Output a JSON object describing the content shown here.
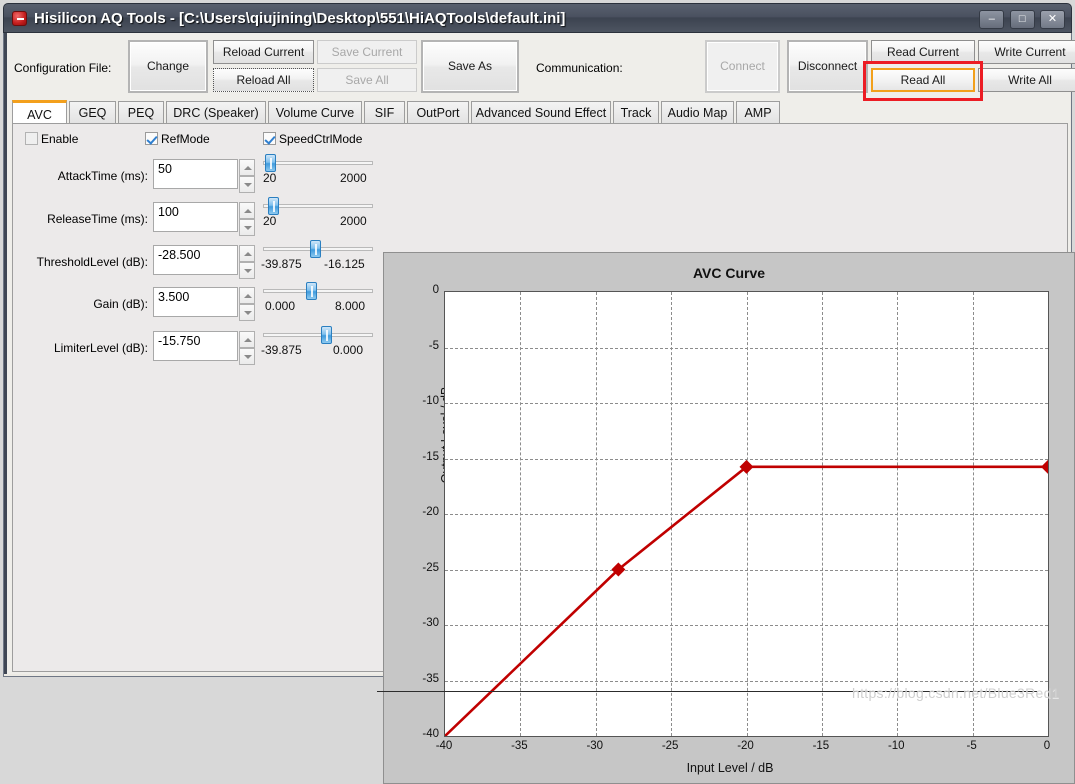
{
  "window": {
    "title": "Hisilicon AQ Tools - [C:\\Users\\qiujining\\Desktop\\551\\HiAQTools\\default.ini]",
    "app_icon": "app-icon",
    "minimize": "–",
    "maximize": "□",
    "close": "✕"
  },
  "toolbar": {
    "config_label": "Configuration File:",
    "change": "Change",
    "reload_current": "Reload Current",
    "reload_all": "Reload All",
    "save_current": "Save Current",
    "save_all": "Save All",
    "save_as": "Save As",
    "communication_label": "Communication:",
    "connect": "Connect",
    "disconnect": "Disconnect",
    "read_current": "Read Current",
    "read_all": "Read All",
    "write_current": "Write Current",
    "write_all": "Write All",
    "highlight_color": "#f2a01b",
    "annotation_color": "#ec1c24"
  },
  "tabs": [
    {
      "label": "AVC",
      "active": true
    },
    {
      "label": "GEQ",
      "active": false
    },
    {
      "label": "PEQ",
      "active": false
    },
    {
      "label": "DRC (Speaker)",
      "active": false
    },
    {
      "label": "Volume Curve",
      "active": false
    },
    {
      "label": "SIF",
      "active": false
    },
    {
      "label": "OutPort",
      "active": false
    },
    {
      "label": "Advanced Sound Effect",
      "active": false
    },
    {
      "label": "Track",
      "active": false
    },
    {
      "label": "Audio Map",
      "active": false
    },
    {
      "label": "AMP",
      "active": false
    }
  ],
  "avc": {
    "checkboxes": [
      {
        "label": "Enable",
        "checked": false
      },
      {
        "label": "RefMode",
        "checked": true
      },
      {
        "label": "SpeedCtrlMode",
        "checked": true
      }
    ],
    "params": [
      {
        "label": "AttackTime (ms):",
        "value": "50",
        "min": "20",
        "max": "2000",
        "thumb_pct": 2
      },
      {
        "label": "ReleaseTime (ms):",
        "value": "100",
        "min": "20",
        "max": "2000",
        "thumb_pct": 4
      },
      {
        "label": "ThresholdLevel (dB):",
        "value": "-28.500",
        "min": "-39.875",
        "max": "-16.125",
        "thumb_pct": 48
      },
      {
        "label": "Gain (dB):",
        "value": "3.500",
        "min": "0.000",
        "max": "8.000",
        "thumb_pct": 44
      },
      {
        "label": "LimiterLevel (dB):",
        "value": "-15.750",
        "min": "-39.875",
        "max": "0.000",
        "thumb_pct": 60
      }
    ]
  },
  "chart_data": {
    "type": "line",
    "title": "AVC Curve",
    "xlabel": "Input Level / dB",
    "ylabel": "Output Level / dB",
    "xlim": [
      -40,
      0
    ],
    "ylim": [
      -40,
      0
    ],
    "xticks": [
      -40,
      -35,
      -30,
      -25,
      -20,
      -15,
      -10,
      -5,
      0
    ],
    "yticks": [
      0,
      -5,
      -10,
      -15,
      -20,
      -25,
      -30,
      -35,
      -40
    ],
    "grid": true,
    "legend": "none",
    "line_color": "#c00000",
    "marker": "diamond",
    "series": [
      {
        "name": "AVC Curve",
        "x": [
          -40,
          -28.5,
          -20,
          0
        ],
        "y": [
          -40,
          -25,
          -15.75,
          -15.75
        ],
        "markers_at": [
          [
            -28.5,
            -25
          ],
          [
            -20,
            -15.75
          ],
          [
            0,
            -15.75
          ]
        ]
      }
    ]
  },
  "watermark": "https://blog.csdn.net/Blue3Red1"
}
